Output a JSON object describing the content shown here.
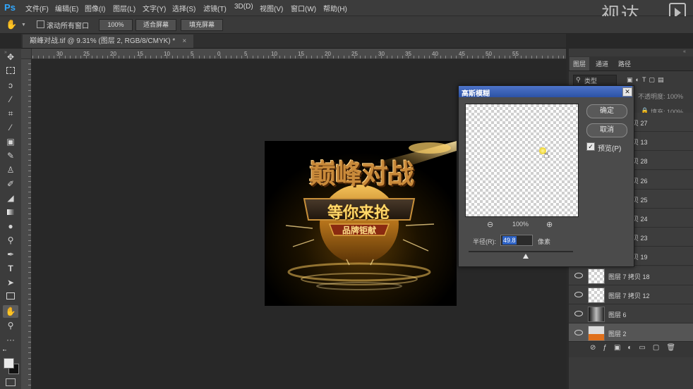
{
  "app": {
    "logo": "Ps",
    "menu": [
      "文件(F)",
      "编辑(E)",
      "图像(I)",
      "图层(L)",
      "文字(Y)",
      "选择(S)",
      "滤镜(T)",
      "3D(D)",
      "视图(V)",
      "窗口(W)",
      "帮助(H)"
    ],
    "watermark": "视达"
  },
  "options_bar": {
    "scroll_all_label": "滚动所有窗口",
    "zoom_value": "100%",
    "fit_screen_label": "适合屏幕",
    "fill_screen_label": "填充屏幕"
  },
  "document": {
    "tab_title": "巅峰对战.tif @ 9.31% (图层 2, RGB/8/CMYK) *"
  },
  "ruler": {
    "top_labels": [
      "30",
      "25",
      "20",
      "15",
      "10",
      "5",
      "0",
      "5",
      "10",
      "15",
      "20",
      "25",
      "30",
      "35",
      "40",
      "45",
      "50",
      "55"
    ]
  },
  "artwork": {
    "title": "巅峰对战",
    "subtitle": "等你来抢",
    "tagline": "品牌钜献"
  },
  "panels": {
    "tabs": [
      "图层",
      "通道",
      "路径"
    ],
    "search_label": "类型",
    "opacity_label": "不透明度: 100%",
    "fill_label": "填充: 100%",
    "layers": [
      {
        "name": "贝 27",
        "thumb": "checker"
      },
      {
        "name": "贝 13",
        "thumb": "checker"
      },
      {
        "name": "贝 28",
        "thumb": "checker"
      },
      {
        "name": "贝 26",
        "thumb": "checker"
      },
      {
        "name": "贝 25",
        "thumb": "checker"
      },
      {
        "name": "贝 24",
        "thumb": "checker"
      },
      {
        "name": "贝 23",
        "thumb": "checker"
      },
      {
        "name": "贝 19",
        "thumb": "checker"
      },
      {
        "name": "图层 7 拷贝 18",
        "thumb": "checker"
      },
      {
        "name": "图层 7 拷贝 12",
        "thumb": "checker"
      },
      {
        "name": "图层 6",
        "thumb": "dark"
      },
      {
        "name": "图层 2",
        "thumb": "orange"
      }
    ]
  },
  "dialog": {
    "title": "高斯模糊",
    "ok_label": "确定",
    "cancel_label": "取消",
    "preview_label": "预览(P)",
    "preview_checked": true,
    "zoom_value": "100%",
    "radius_label": "半径(R):",
    "radius_value": "49.8",
    "radius_unit": "像素"
  },
  "colors": {
    "accent": "#31a8ff",
    "dialog_title_bar": "#2c52a5",
    "gold": "#e0a53a"
  }
}
